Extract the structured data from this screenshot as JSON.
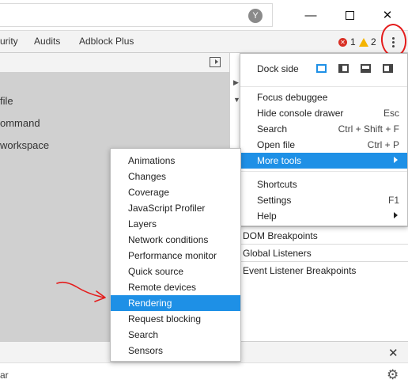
{
  "window": {
    "address_icon": "Y",
    "controls": [
      "minimize-icon",
      "maximize-icon",
      "close-icon"
    ]
  },
  "tabs": [
    "urity",
    "Audits",
    "Adblock Plus"
  ],
  "status": {
    "errors": "1",
    "warnings": "2"
  },
  "left_panel": {
    "items": [
      "file",
      "ommand",
      "workspace"
    ]
  },
  "main_menu": {
    "dock_side_label": "Dock side",
    "items": [
      {
        "label": "Focus debuggee",
        "shortcut": ""
      },
      {
        "label": "Hide console drawer",
        "shortcut": "Esc"
      },
      {
        "label": "Search",
        "shortcut": "Ctrl + Shift + F"
      },
      {
        "label": "Open file",
        "shortcut": "Ctrl + P"
      },
      {
        "label": "More tools",
        "shortcut": ""
      },
      {
        "label": "Shortcuts",
        "shortcut": ""
      },
      {
        "label": "Settings",
        "shortcut": "F1"
      },
      {
        "label": "Help",
        "shortcut": ""
      }
    ]
  },
  "more_tools_menu": {
    "items": [
      "Animations",
      "Changes",
      "Coverage",
      "JavaScript Profiler",
      "Layers",
      "Network conditions",
      "Performance monitor",
      "Quick source",
      "Remote devices",
      "Rendering",
      "Request blocking",
      "Search",
      "Sensors"
    ],
    "highlighted": "Rendering"
  },
  "breakpoints": [
    "DOM Breakpoints",
    "Global Listeners",
    "Event Listener Breakpoints"
  ],
  "drawer": {
    "text": "ar"
  },
  "colors": {
    "highlight": "#1e90e6",
    "annotation": "#e41c1c",
    "error": "#d93025",
    "warning": "#f4b400"
  }
}
